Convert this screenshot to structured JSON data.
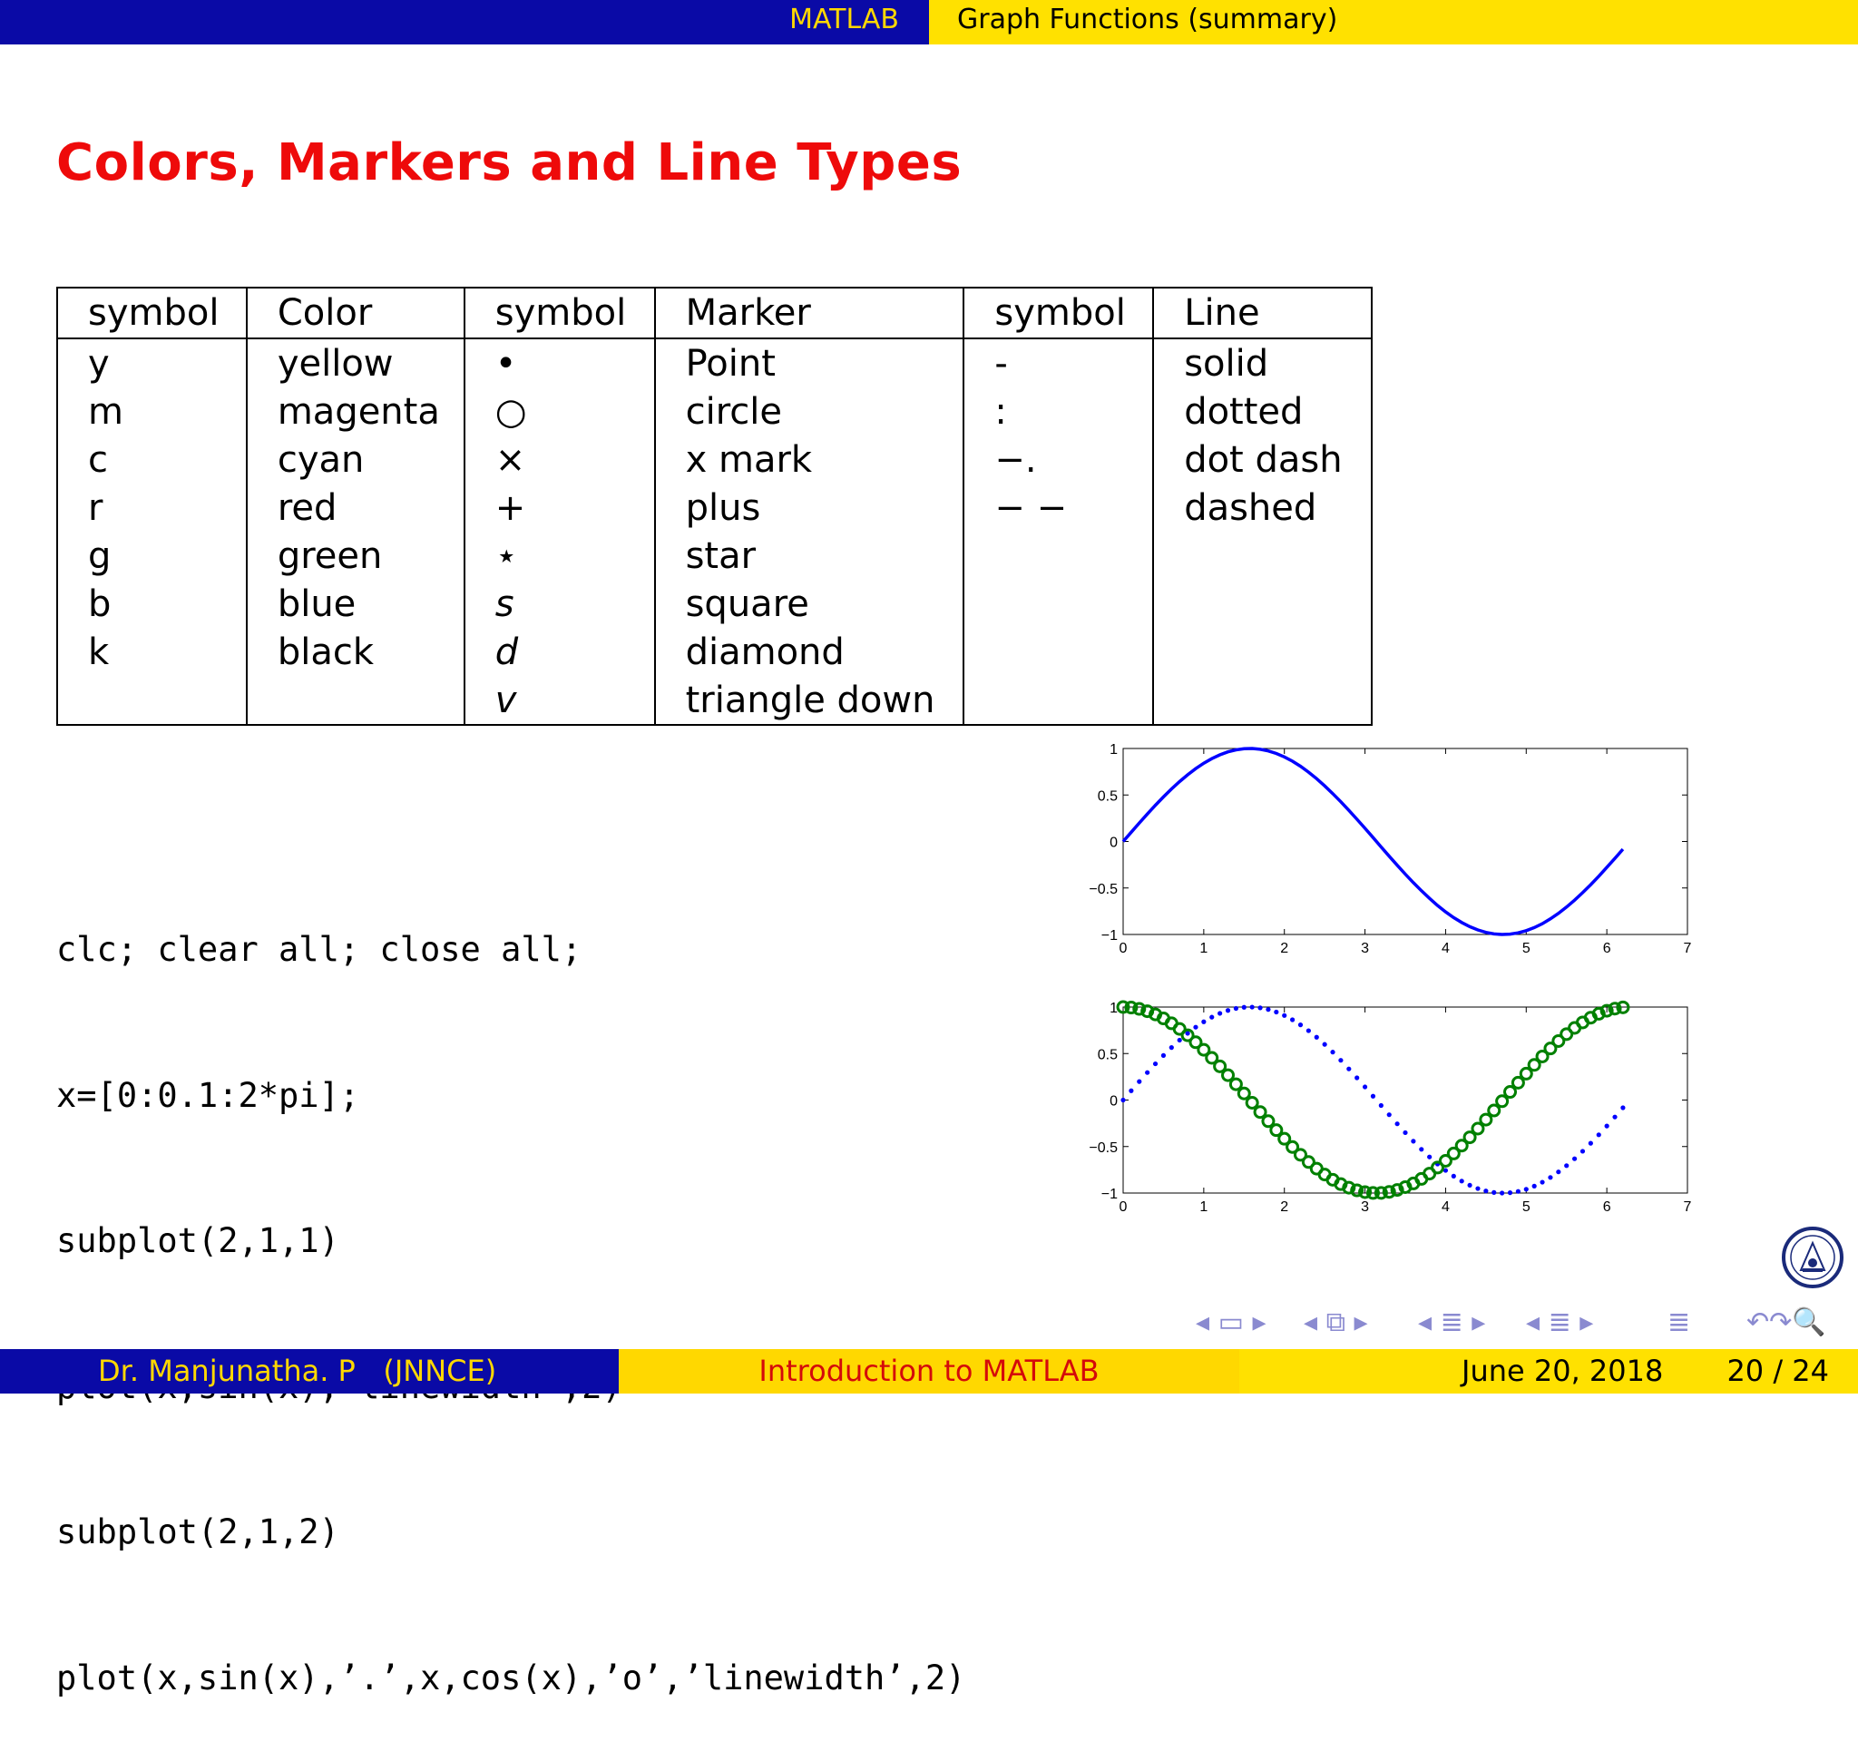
{
  "header": {
    "section": "MATLAB",
    "subsection": "Graph Functions (summary)"
  },
  "frame_title": "Colors, Markers and Line Types",
  "table": {
    "headers": [
      "symbol",
      "Color",
      "symbol",
      "Marker",
      "symbol",
      "Line"
    ],
    "rows": [
      [
        "y",
        "yellow",
        "•",
        "Point",
        "-",
        "solid"
      ],
      [
        "m",
        "magenta",
        "○",
        "circle",
        ":",
        "dotted"
      ],
      [
        "c",
        "cyan",
        "×",
        "x mark",
        "−.",
        "dot dash"
      ],
      [
        "r",
        "red",
        "+",
        "plus",
        "− −",
        "dashed"
      ],
      [
        "g",
        "green",
        "⋆",
        "star",
        "",
        ""
      ],
      [
        "b",
        "blue",
        "s",
        "square",
        "",
        ""
      ],
      [
        "k",
        "black",
        "d",
        "diamond",
        "",
        ""
      ],
      [
        "",
        "",
        "v",
        "triangle down",
        "",
        ""
      ]
    ]
  },
  "code_lines": [
    "clc; clear all; close all;",
    "x=[0:0.1:2*pi];",
    "subplot(2,1,1)",
    "plot(x,sin(x),’linewidth’,2)",
    "subplot(2,1,2)",
    "plot(x,sin(x),’.’,x,cos(x),’o’,’linewidth’,2)"
  ],
  "chart_data": [
    {
      "type": "line",
      "x_formula": "x = 0:0.1:2*pi",
      "series": [
        {
          "formula": "sin(x)",
          "color": "#0000ff",
          "style": "solid",
          "linewidth": 2
        }
      ],
      "xlim": [
        0,
        7
      ],
      "ylim": [
        -1,
        1
      ],
      "xticks": [
        "0",
        "1",
        "2",
        "3",
        "4",
        "5",
        "6",
        "7"
      ],
      "yticks": [
        "1",
        "0.5",
        "0",
        "−0.5",
        "−1"
      ]
    },
    {
      "type": "line",
      "x_formula": "x = 0:0.1:2*pi",
      "series": [
        {
          "formula": "sin(x)",
          "color": "#0000ff",
          "style": "point"
        },
        {
          "formula": "cos(x)",
          "color": "#008000",
          "style": "circle",
          "linewidth": 2
        }
      ],
      "xlim": [
        0,
        7
      ],
      "ylim": [
        -1,
        1
      ],
      "xticks": [
        "0",
        "1",
        "2",
        "3",
        "4",
        "5",
        "6",
        "7"
      ],
      "yticks": [
        "1",
        "0.5",
        "0",
        "−0.5",
        "−1"
      ]
    }
  ],
  "nav_icons": [
    "nav-frame-icon",
    "nav-subsection-icon",
    "nav-section-icon",
    "nav-document-icon",
    "nav-align-icon",
    "nav-search-icon"
  ],
  "footer": {
    "author": "Dr. Manjunatha. P   (JNNCE)",
    "title": "Introduction to MATLAB",
    "date": "June 20, 2018",
    "page": "20 / 24"
  },
  "colors": {
    "blue_bar": "#0a0aa6",
    "yellow_bar": "#ffe100",
    "title_red": "#ee0a0a"
  }
}
